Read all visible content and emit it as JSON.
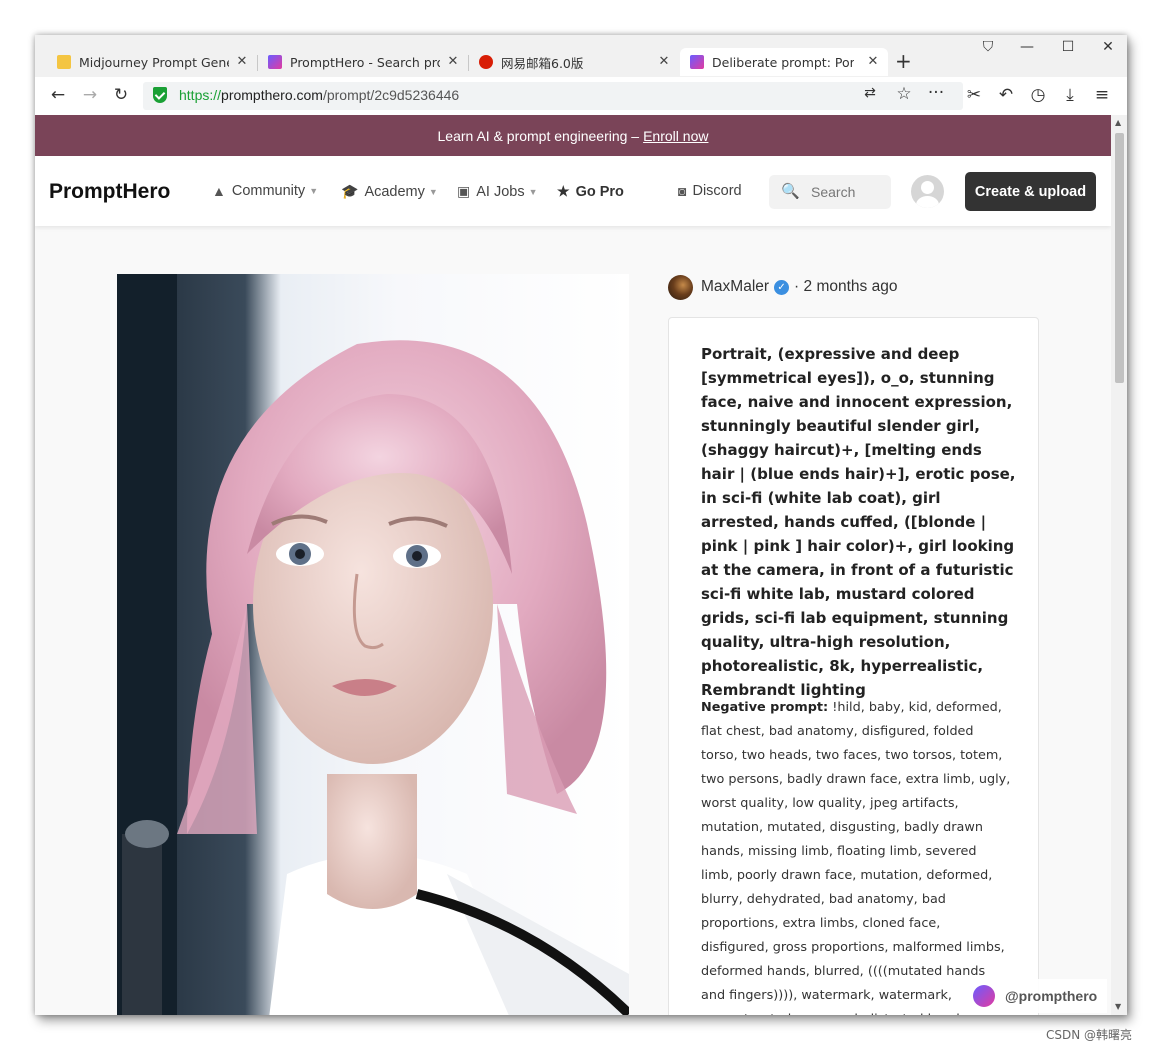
{
  "browser": {
    "tabs": [
      {
        "title": "Midjourney Prompt Gene",
        "favicon": "smiley-icon",
        "active": false
      },
      {
        "title": "PromptHero - Search pro",
        "favicon": "prompthero-icon",
        "active": false
      },
      {
        "title": "网易邮箱6.0版",
        "favicon": "netease-icon",
        "active": false
      },
      {
        "title": "Deliberate prompt: Portra",
        "favicon": "prompthero-icon",
        "active": true
      }
    ],
    "url": {
      "scheme": "https://",
      "host": "prompthero.com",
      "path": "/prompt/2c9d5236446"
    }
  },
  "banner": {
    "text": "Learn AI & prompt engineering –",
    "link": "Enroll now"
  },
  "header": {
    "logo": "PromptHero",
    "nav": [
      {
        "label": "Community",
        "icon": "community-icon",
        "has_caret": true
      },
      {
        "label": "Academy",
        "icon": "graduation-cap-icon",
        "has_caret": true
      },
      {
        "label": "AI Jobs",
        "icon": "briefcase-icon",
        "has_caret": true
      },
      {
        "label": "Go Pro",
        "icon": "star-icon",
        "has_caret": false
      },
      {
        "label": "Discord",
        "icon": "discord-icon",
        "has_caret": false
      }
    ],
    "search_label": "Search",
    "cta": "Create & upload"
  },
  "post": {
    "author": "MaxMaler",
    "time": "· 2 months ago",
    "prompt": "Portrait, (expressive and deep [symmetrical eyes]), o_o, stunning face, naive and innocent expression, stunningly beautiful slender girl, (shaggy haircut)+, [melting ends hair | (blue ends hair)+], erotic pose, in sci-fi (white lab coat), girl arrested, hands cuffed, ([blonde | pink | pink ] hair color)+, girl looking at the camera, in front of a futuristic sci-fi white lab, mustard colored grids, sci-fi lab equipment, stunning quality, ultra-high resolution, photorealistic, 8k, hyperrealistic, Rembrandt lighting",
    "negative_label": "Negative prompt:",
    "negative": "!hild, baby, kid, deformed, flat chest, bad anatomy, disfigured, folded torso, two heads, two faces, two torsos, totem, two persons, badly drawn face, extra limb, ugly, worst quality, low quality, jpeg artifacts, mutation, mutated, disgusting, badly drawn hands, missing limb, floating limb, severed limb, poorly drawn face, mutation, deformed, blurry, dehydrated, bad anatomy, bad proportions, extra limbs, cloned face, disfigured, gross proportions, malformed limbs, deformed hands, blurred, ((((mutated hands and fingers)))), watermark, watermark, oversaturated, censored, distorted hands, amputation, missing hands, obese, doubled face, double hands"
  },
  "watermark": "@prompthero",
  "csdn_mark": "CSDN @韩曙亮"
}
